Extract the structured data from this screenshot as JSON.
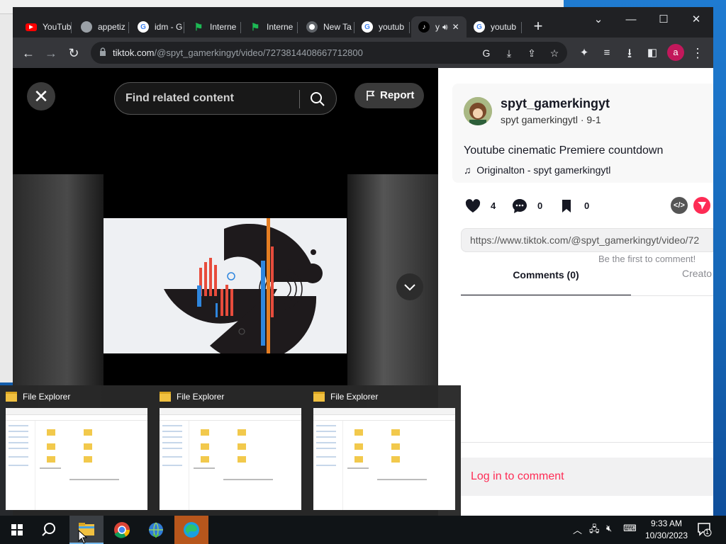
{
  "browser": {
    "tabs": [
      {
        "title": "YouTub",
        "icon": "youtube-icon"
      },
      {
        "title": "appetiz",
        "icon": "globe-icon"
      },
      {
        "title": "idm - G",
        "icon": "google-icon"
      },
      {
        "title": "Interne",
        "icon": "green-flag-icon"
      },
      {
        "title": "Interne",
        "icon": "green-flag-icon"
      },
      {
        "title": "New Ta",
        "icon": "chrome-icon"
      },
      {
        "title": "youtub",
        "icon": "google-icon"
      },
      {
        "title": "y",
        "icon": "tiktok-icon",
        "active": true
      },
      {
        "title": "youtub",
        "icon": "google-icon"
      }
    ],
    "url_host": "tiktok.com",
    "url_path": "/@spyt_gamerkingyt/video/7273814408667712800",
    "profile_initial": "a"
  },
  "video": {
    "search_placeholder": "Find related content",
    "report_label": "Report"
  },
  "post": {
    "username": "spyt_gamerkingyt",
    "subname": "spyt gamerkingytl · 9-1",
    "caption": "Youtube cinematic Premiere countdown",
    "music": "Originalton - spyt gamerkingytl",
    "likes": "4",
    "comments": "0",
    "saves": "0",
    "embed_label": "</>",
    "link": "https://www.tiktok.com/@spyt_gamerkingyt/video/72",
    "empty_comments": "Be the first to comment!",
    "tab_comments": "Comments (0)",
    "tab_creator": "Creato",
    "login_prompt": "Log in to comment"
  },
  "previews": [
    {
      "title": "File Explorer"
    },
    {
      "title": "File Explorer"
    },
    {
      "title": "File Explorer"
    }
  ],
  "taskbar": {
    "time": "9:33 AM",
    "date": "10/30/2023",
    "notification_count": "1"
  },
  "colors": {
    "tiktok_red": "#fe2c55",
    "chrome_dark": "#202124",
    "taskbar": "#101417"
  }
}
